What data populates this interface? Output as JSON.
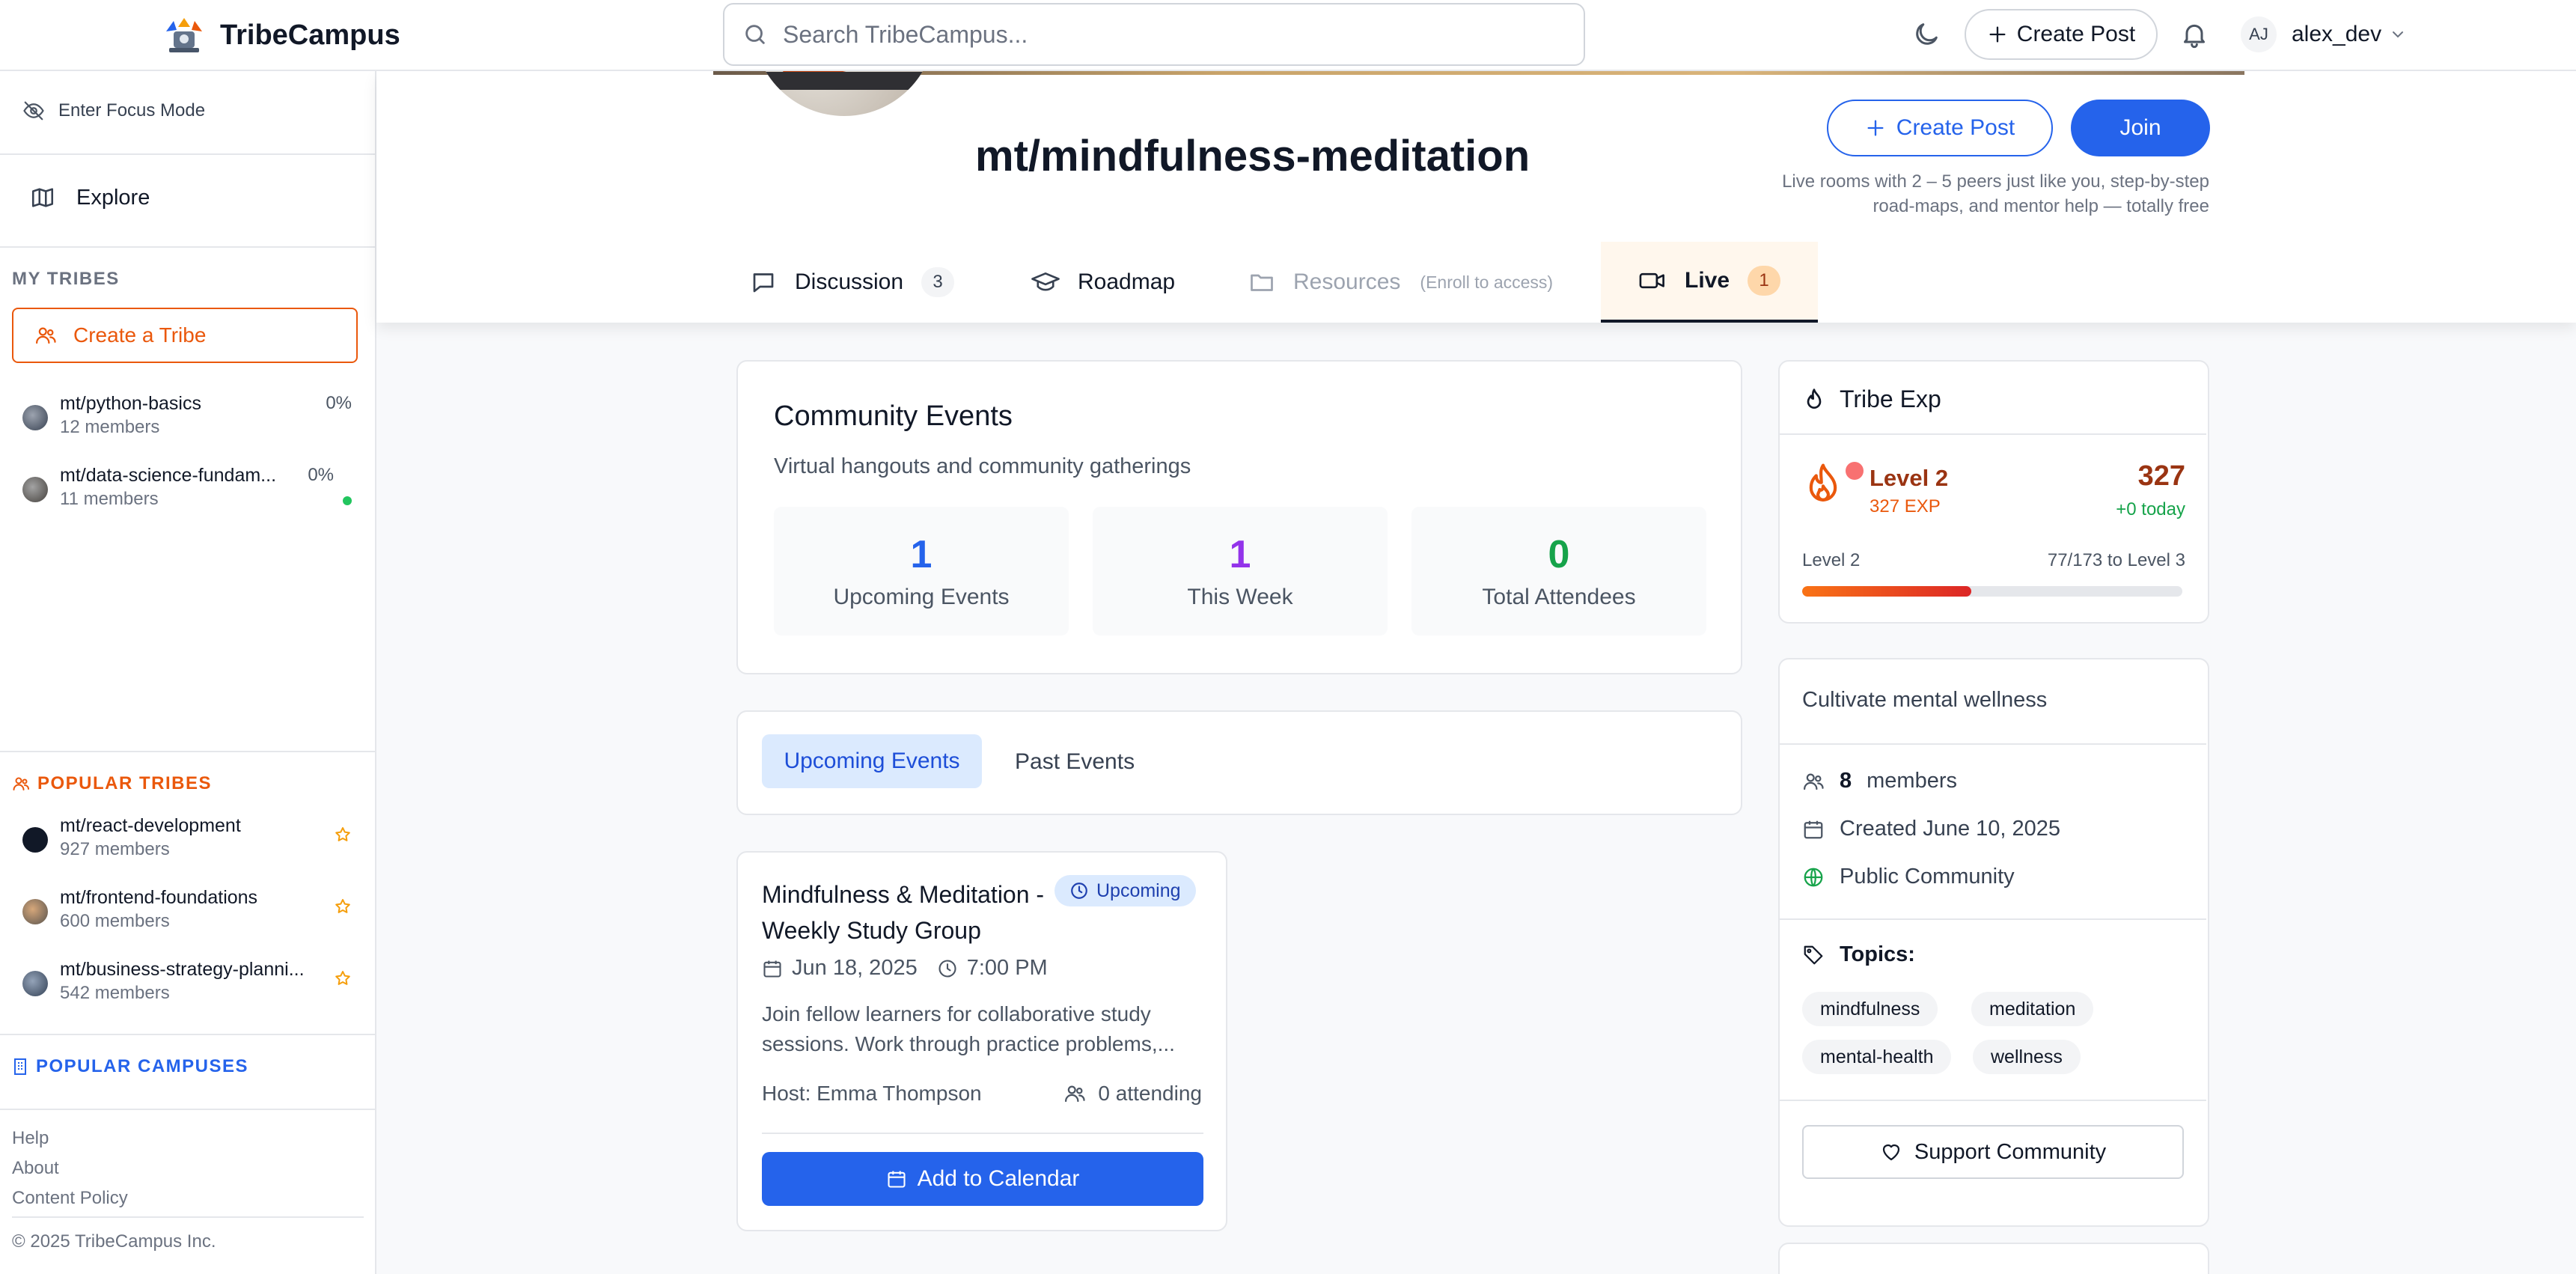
{
  "header": {
    "brand": "TribeCampus",
    "search_placeholder": "Search TribeCampus...",
    "create_post_label": "Create Post",
    "user_initials": "AJ",
    "username": "alex_dev"
  },
  "sidebar": {
    "focus_mode_label": "Enter Focus Mode",
    "explore_label": "Explore",
    "my_tribes_heading": "MY TRIBES",
    "create_tribe_label": "Create a Tribe",
    "my_tribes": [
      {
        "name": "mt/python-basics",
        "members": "12 members",
        "progress": "0%"
      },
      {
        "name": "mt/data-science-fundam...",
        "members": "11 members",
        "progress": "0%"
      }
    ],
    "popular_tribes_heading": "POPULAR TRIBES",
    "popular_tribes": [
      {
        "name": "mt/react-development",
        "members": "927 members"
      },
      {
        "name": "mt/frontend-foundations",
        "members": "600 members"
      },
      {
        "name": "mt/business-strategy-planni...",
        "members": "542 members"
      }
    ],
    "popular_campuses_heading": "POPULAR CAMPUSES",
    "footer_links": [
      "Help",
      "About",
      "Content Policy"
    ],
    "copyright": "© 2025 TribeCampus Inc."
  },
  "community": {
    "title": "mt/mindfulness-meditation",
    "create_post_label": "Create Post",
    "join_label": "Join",
    "description_line1": "Live rooms with 2 – 5 peers just like you, step-by-step",
    "description_line2": "road-maps, and mentor help — totally free",
    "tabs": {
      "discussion": {
        "label": "Discussion",
        "count": "3"
      },
      "roadmap": {
        "label": "Roadmap"
      },
      "resources": {
        "label": "Resources",
        "note": "(Enroll to access)"
      },
      "live": {
        "label": "Live",
        "count": "1"
      }
    }
  },
  "events": {
    "title": "Community Events",
    "subtitle": "Virtual hangouts and community gatherings",
    "stats": [
      {
        "value": "1",
        "label": "Upcoming Events",
        "color": "#2563eb"
      },
      {
        "value": "1",
        "label": "This Week",
        "color": "#9333ea"
      },
      {
        "value": "0",
        "label": "Total Attendees",
        "color": "#16a34a"
      }
    ],
    "tab_upcoming": "Upcoming Events",
    "tab_past": "Past Events",
    "event": {
      "title": "Mindfulness & Meditation - Weekly Study Group",
      "badge": "Upcoming",
      "date": "Jun 18, 2025",
      "time": "7:00 PM",
      "description_line1": "Join fellow learners for collaborative study",
      "description_line2": "sessions. Work through practice problems,...",
      "host": "Host: Emma Thompson",
      "attending": "0 attending",
      "button": "Add to Calendar"
    }
  },
  "tribe_exp": {
    "title": "Tribe Exp",
    "level": "Level 2",
    "exp": "327 EXP",
    "points": "327",
    "today": "+0 today",
    "bar_left": "Level 2",
    "bar_right": "77/173 to Level 3",
    "progress_fraction": 0.445
  },
  "about": {
    "tagline": "Cultivate mental wellness",
    "member_count": "8",
    "members_label": "members",
    "created": "Created June 10, 2025",
    "visibility": "Public Community",
    "topics_label": "Topics:",
    "topics": [
      "mindfulness",
      "meditation",
      "mental-health",
      "wellness"
    ],
    "support_label": "Support Community"
  },
  "colors": {
    "primary": "#2563eb",
    "accent_orange": "#ea580c",
    "live_tab_bg": "#fff7ed"
  }
}
